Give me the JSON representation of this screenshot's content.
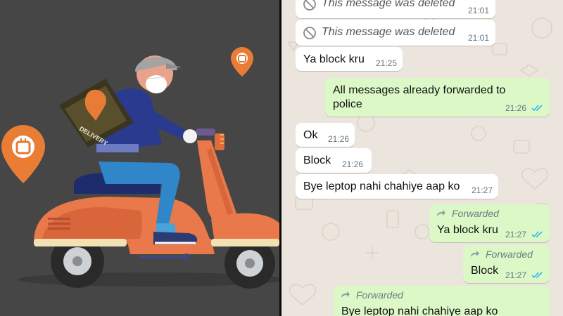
{
  "colors": {
    "incoming_bubble": "#ffffff",
    "outgoing_bubble": "#dcf8c6",
    "chat_background": "#ece5dd",
    "read_ticks": "#34b7f1",
    "brand_orange": "#ee7f43",
    "illustration_bg": "#464646"
  },
  "illustration": {
    "bag_text": "DELIVERY",
    "pins": [
      "swiggy-pin-icon",
      "swiggy-pin-icon"
    ]
  },
  "chat": {
    "messages": [
      {
        "direction": "in",
        "deleted": true,
        "text": "This message was deleted",
        "time": "21:01"
      },
      {
        "direction": "in",
        "deleted": true,
        "text": "This message was deleted",
        "time": "21:01"
      },
      {
        "direction": "in",
        "text": "Ya block kru",
        "time": "21:25"
      },
      {
        "direction": "out",
        "text_line1": "All messages already forwarded to",
        "text_line2": "police",
        "time": "21:26",
        "status": "read"
      },
      {
        "direction": "in",
        "text": "Ok",
        "time": "21:26"
      },
      {
        "direction": "in",
        "text": "Block",
        "time": "21:26"
      },
      {
        "direction": "in",
        "text": "Bye leptop nahi chahiye aap ko",
        "time": "21:27"
      },
      {
        "direction": "out",
        "forwarded_label": "Forwarded",
        "text": "Ya block kru",
        "time": "21:27",
        "status": "read"
      },
      {
        "direction": "out",
        "forwarded_label": "Forwarded",
        "text": "Block",
        "time": "21:27",
        "status": "read"
      },
      {
        "direction": "out",
        "forwarded_label": "Forwarded",
        "text": "Bye leptop nahi chahiye aap ko",
        "time": "",
        "status": ""
      }
    ]
  }
}
